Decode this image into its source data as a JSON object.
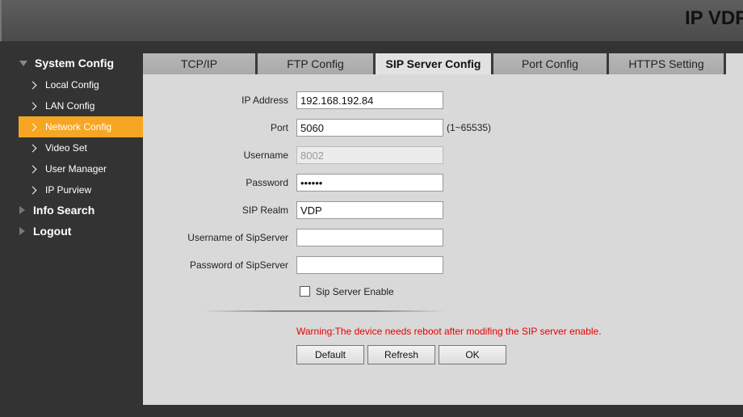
{
  "header": {
    "brand": "IP VDP"
  },
  "sidebar": {
    "groups": [
      {
        "label": "System Config",
        "expanded": true
      },
      {
        "label": "Info Search",
        "expanded": false
      },
      {
        "label": "Logout",
        "expanded": false
      }
    ],
    "items": [
      {
        "label": "Local Config"
      },
      {
        "label": "LAN Config"
      },
      {
        "label": "Network Config",
        "active": true
      },
      {
        "label": "Video Set"
      },
      {
        "label": "User Manager"
      },
      {
        "label": "IP Purview"
      }
    ],
    "active_color": "#f6a623"
  },
  "tabs": [
    {
      "label": "TCP/IP"
    },
    {
      "label": "FTP Config"
    },
    {
      "label": "SIP Server Config",
      "active": true
    },
    {
      "label": "Port Config"
    },
    {
      "label": "HTTPS Setting"
    }
  ],
  "form": {
    "ip_address": {
      "label": "IP Address",
      "value": "192.168.192.84"
    },
    "port": {
      "label": "Port",
      "value": "5060",
      "hint": "(1~65535)"
    },
    "username": {
      "label": "Username",
      "value": "8002"
    },
    "password": {
      "label": "Password",
      "value": "••••••"
    },
    "sip_realm": {
      "label": "SIP Realm",
      "value": "VDP"
    },
    "sip_username": {
      "label": "Username of SipServer",
      "value": ""
    },
    "sip_password": {
      "label": "Password of SipServer",
      "value": ""
    },
    "enable": {
      "label": "Sip Server Enable",
      "checked": false
    }
  },
  "warning": "Warning:The device needs reboot after modifing the SIP server enable.",
  "buttons": {
    "default": "Default",
    "refresh": "Refresh",
    "ok": "OK"
  },
  "colors": {
    "warning": "#e60000"
  }
}
